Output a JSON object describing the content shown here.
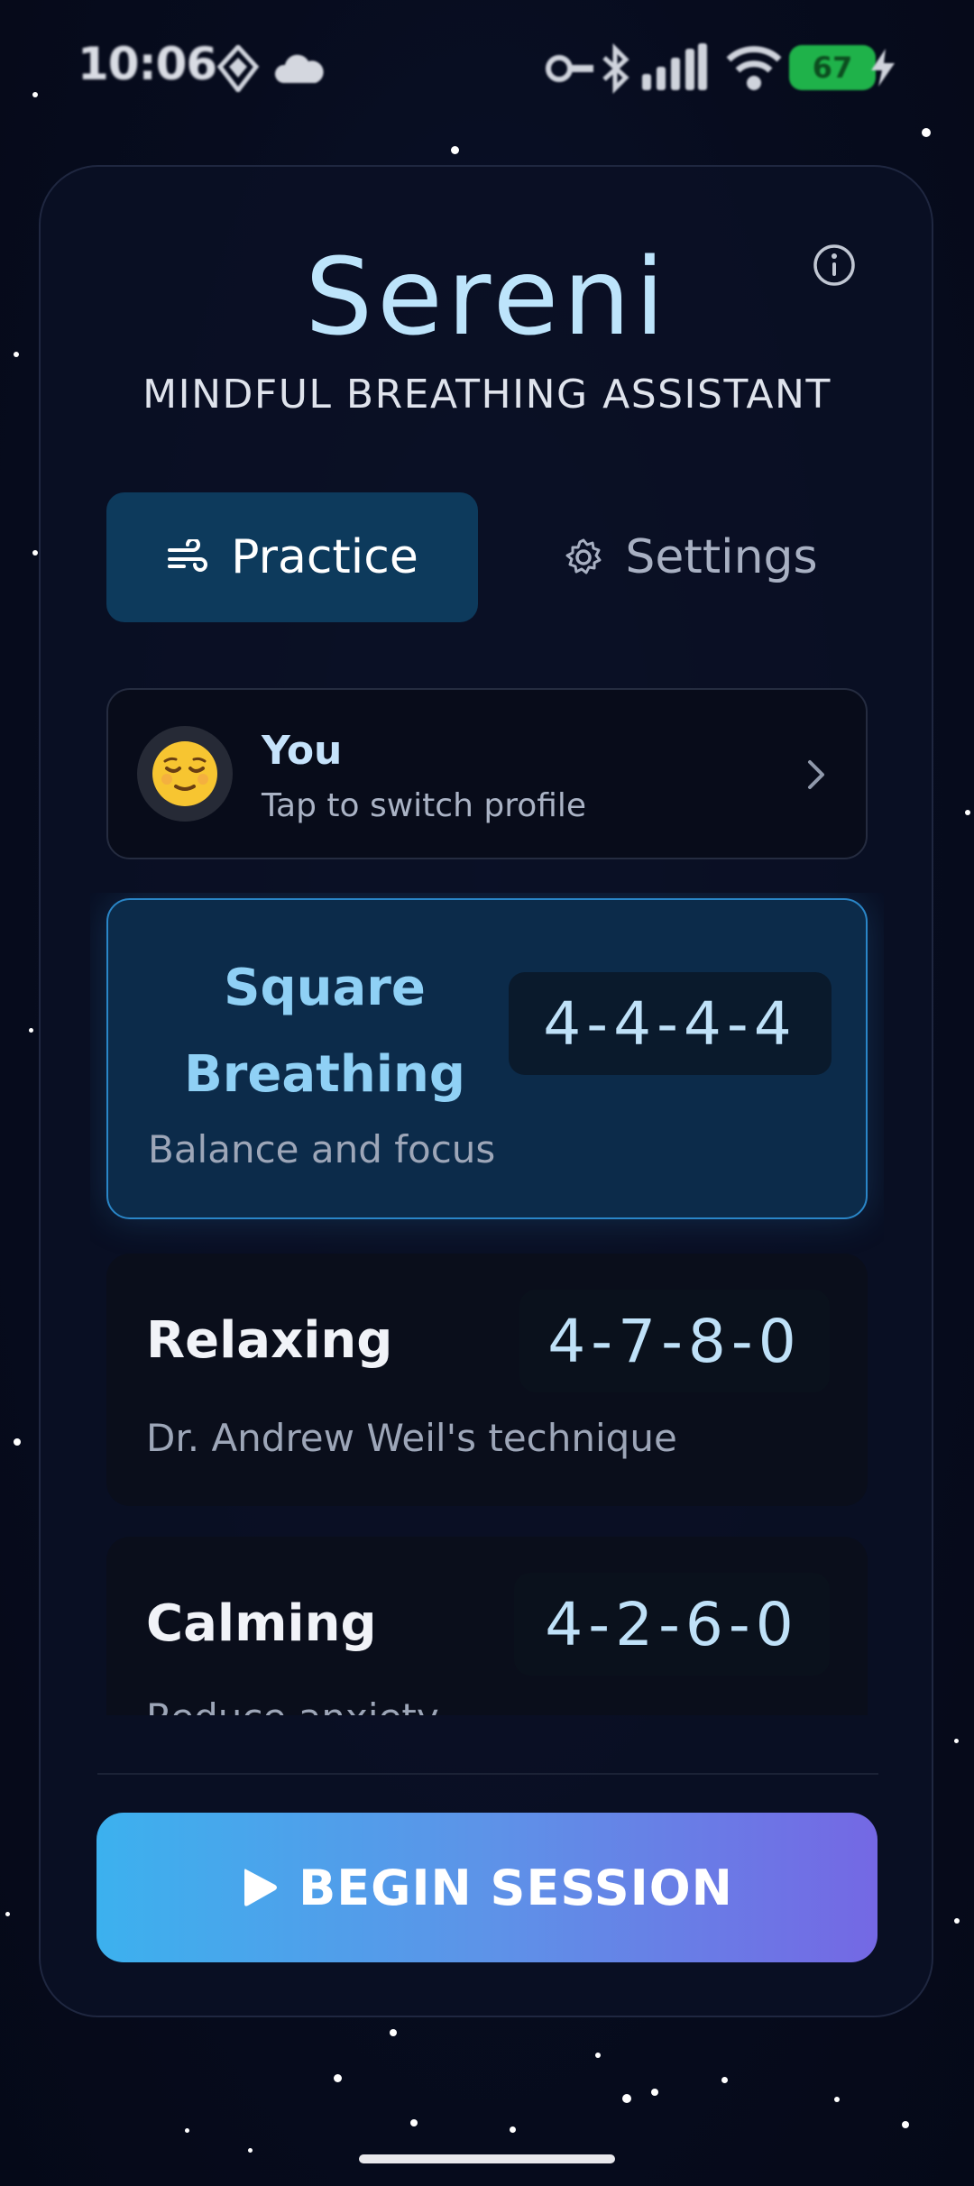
{
  "status_bar": {
    "time": "10:06",
    "battery": "67"
  },
  "app": {
    "title": "Sereni",
    "subtitle": "MINDFUL BREATHING ASSISTANT"
  },
  "tabs": [
    {
      "label": "Practice",
      "icon": "wind-icon",
      "active": true
    },
    {
      "label": "Settings",
      "icon": "gear-icon",
      "active": false
    }
  ],
  "profile": {
    "emoji": "😌",
    "name": "You",
    "hint": "Tap to switch profile"
  },
  "techniques": [
    {
      "name": "Square Breathing",
      "description": "Balance and focus",
      "pattern": "4-4-4-4",
      "selected": true
    },
    {
      "name": "Relaxing",
      "description": "Dr. Andrew Weil's technique",
      "pattern": "4-7-8-0",
      "selected": false
    },
    {
      "name": "Calming",
      "description": "Reduce anxiety",
      "pattern": "4-2-6-0",
      "selected": false
    }
  ],
  "begin_button": {
    "label": "BEGIN SESSION"
  },
  "colors": {
    "accent": "#8fd0f5",
    "selected_card": "#0c2b4a",
    "button_gradient_start": "#3cb1ee",
    "button_gradient_end": "#7468e4"
  }
}
